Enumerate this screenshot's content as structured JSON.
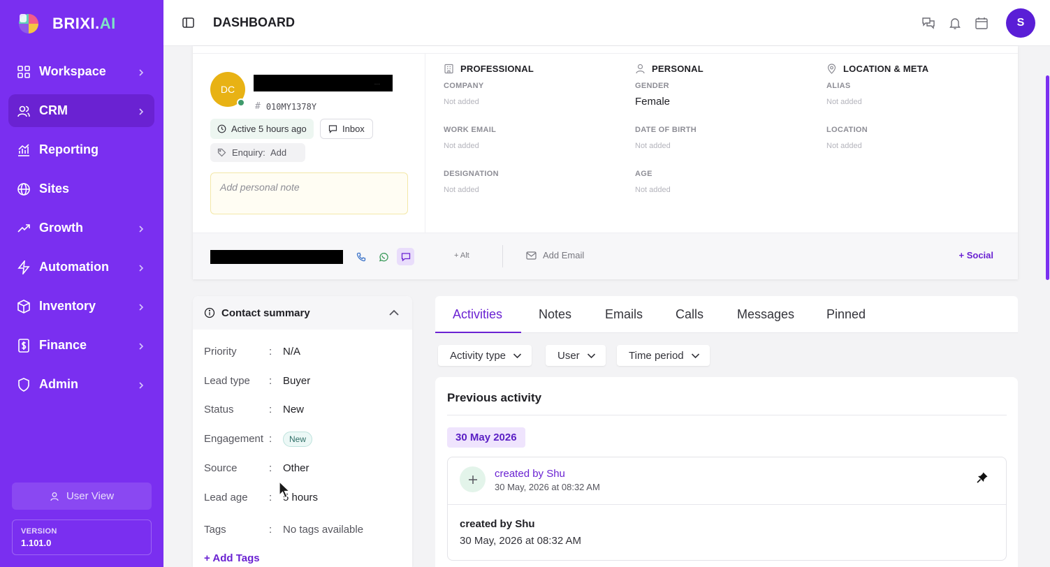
{
  "brand": {
    "name_main": "BRIXI.",
    "name_accent": "AI",
    "accent_color": "#7fe3c7",
    "sidebar_color": "#7a2ff0"
  },
  "sidebar": {
    "items": [
      {
        "label": "Workspace",
        "icon": "grid-icon",
        "chevron": true
      },
      {
        "label": "CRM",
        "icon": "users-icon",
        "chevron": true,
        "active": true
      },
      {
        "label": "Reporting",
        "icon": "bar-chart-icon",
        "chevron": false
      },
      {
        "label": "Sites",
        "icon": "globe-icon",
        "chevron": false
      },
      {
        "label": "Growth",
        "icon": "trending-up-icon",
        "chevron": true
      },
      {
        "label": "Automation",
        "icon": "lightning-icon",
        "chevron": true
      },
      {
        "label": "Inventory",
        "icon": "box-icon",
        "chevron": true
      },
      {
        "label": "Finance",
        "icon": "dollar-receipt-icon",
        "chevron": true
      },
      {
        "label": "Admin",
        "icon": "shield-icon",
        "chevron": true
      }
    ],
    "user_view": "User View",
    "version_label": "VERSION",
    "version_value": "1.101.0"
  },
  "topbar": {
    "title": "DASHBOARD",
    "avatar_initial": "S"
  },
  "profile": {
    "initials": "DC",
    "name_redacted_hint": "...",
    "contact_id": "010MY1378Y",
    "active_status": "Active 5 hours ago",
    "inbox_label": "Inbox",
    "enquiry_label": "Enquiry:",
    "enquiry_action": "Add",
    "note_placeholder": "Add personal note",
    "professional": {
      "heading": "PROFESSIONAL",
      "company_label": "COMPANY",
      "company_value": "Not added",
      "work_email_label": "WORK EMAIL",
      "work_email_value": "Not added",
      "designation_label": "DESIGNATION",
      "designation_value": "Not added"
    },
    "personal": {
      "heading": "PERSONAL",
      "gender_label": "GENDER",
      "gender_value": "Female",
      "dob_label": "DATE OF BIRTH",
      "dob_value": "Not added",
      "age_label": "AGE",
      "age_value": "Not added"
    },
    "location": {
      "heading": "LOCATION & META",
      "alias_label": "ALIAS",
      "alias_value": "Not added",
      "location_label": "LOCATION",
      "location_value": "Not added"
    },
    "alt_label": "+ Alt",
    "add_email_label": "Add Email",
    "social_label": "+ Social"
  },
  "summary": {
    "title": "Contact summary",
    "rows": [
      {
        "key": "Priority",
        "value": "N/A"
      },
      {
        "key": "Lead type",
        "value": "Buyer"
      },
      {
        "key": "Status",
        "value": "New"
      },
      {
        "key": "Engagement",
        "value": "New"
      },
      {
        "key": "Source",
        "value": "Other"
      },
      {
        "key": "Lead age",
        "value": "5 hours"
      },
      {
        "key": "Tags",
        "value": "No tags available"
      }
    ],
    "colon": ":",
    "add_tags": "+ Add Tags"
  },
  "activity": {
    "tabs": [
      "Activities",
      "Notes",
      "Emails",
      "Calls",
      "Messages",
      "Pinned"
    ],
    "active_tab": "Activities",
    "filters": [
      "Activity type",
      "User",
      "Time period"
    ],
    "section_title": "Previous activity",
    "date_group": "30 May 2026",
    "entry": {
      "title": "created by Shu",
      "time": "30 May, 2026 at 08:32 AM",
      "body_title": "created by Shu",
      "body_time": "30 May, 2026 at 08:32 AM"
    }
  }
}
